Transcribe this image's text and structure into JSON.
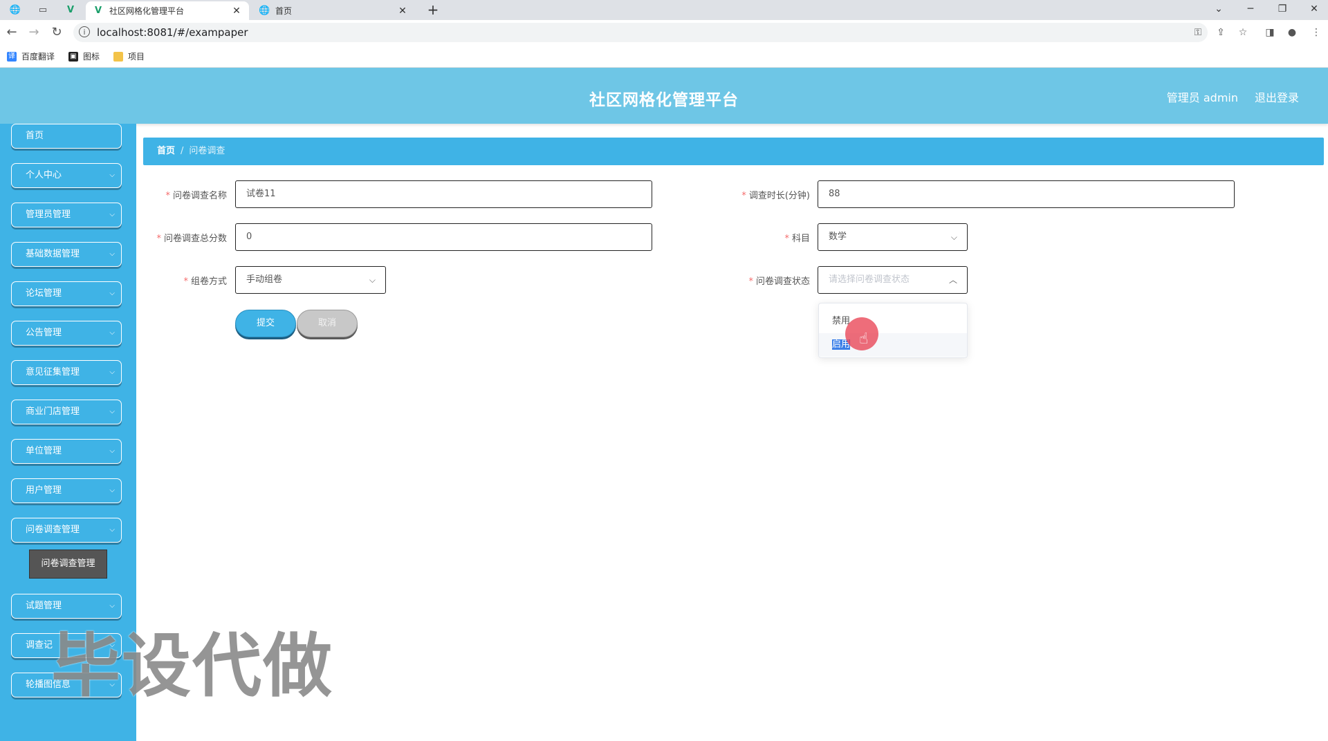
{
  "browser": {
    "tabs": [
      {
        "title": "社区网格化管理平台",
        "active": true
      },
      {
        "title": "首页",
        "active": false
      }
    ],
    "url": "localhost:8081/#/exampaper",
    "bookmarks": [
      {
        "label": "百度翻译",
        "icon": "translate-icon",
        "color": "#3385ff"
      },
      {
        "label": "图标",
        "icon": "image-icon",
        "color": "#222222"
      },
      {
        "label": "项目",
        "icon": "folder-icon",
        "color": "#f3c349"
      }
    ]
  },
  "header": {
    "title": "社区网格化管理平台",
    "user": "管理员 admin",
    "logout": "退出登录",
    "color": "#6ec6e6"
  },
  "sidebar": {
    "color": "#3fb3e6",
    "items": [
      {
        "label": "首页",
        "expandable": false
      },
      {
        "label": "个人中心",
        "expandable": true
      },
      {
        "label": "管理员管理",
        "expandable": true
      },
      {
        "label": "基础数据管理",
        "expandable": true
      },
      {
        "label": "论坛管理",
        "expandable": true
      },
      {
        "label": "公告管理",
        "expandable": true
      },
      {
        "label": "意见征集管理",
        "expandable": true
      },
      {
        "label": "商业门店管理",
        "expandable": true
      },
      {
        "label": "单位管理",
        "expandable": true
      },
      {
        "label": "用户管理",
        "expandable": true
      },
      {
        "label": "问卷调查管理",
        "expandable": true
      },
      {
        "label": "试题管理",
        "expandable": true
      },
      {
        "label": "调查记",
        "expandable": true
      },
      {
        "label": "轮播图信息",
        "expandable": true
      }
    ],
    "submenu": {
      "label": "问卷调查管理"
    }
  },
  "breadcrumb": {
    "home": "首页",
    "separator": "/",
    "current": "问卷调查"
  },
  "form": {
    "name": {
      "label": "问卷调查名称",
      "value": "试卷11"
    },
    "duration": {
      "label": "调查时长(分钟)",
      "value": "88"
    },
    "total_score": {
      "label": "问卷调查总分数",
      "value": "0"
    },
    "subject": {
      "label": "科目",
      "value": "数学"
    },
    "compose_method": {
      "label": "组卷方式",
      "value": "手动组卷"
    },
    "status": {
      "label": "问卷调查状态",
      "placeholder": "请选择问卷调查状态",
      "options": [
        "禁用",
        "启用"
      ]
    }
  },
  "buttons": {
    "submit": "提交",
    "cancel": "取消"
  },
  "watermark": "毕设代做"
}
